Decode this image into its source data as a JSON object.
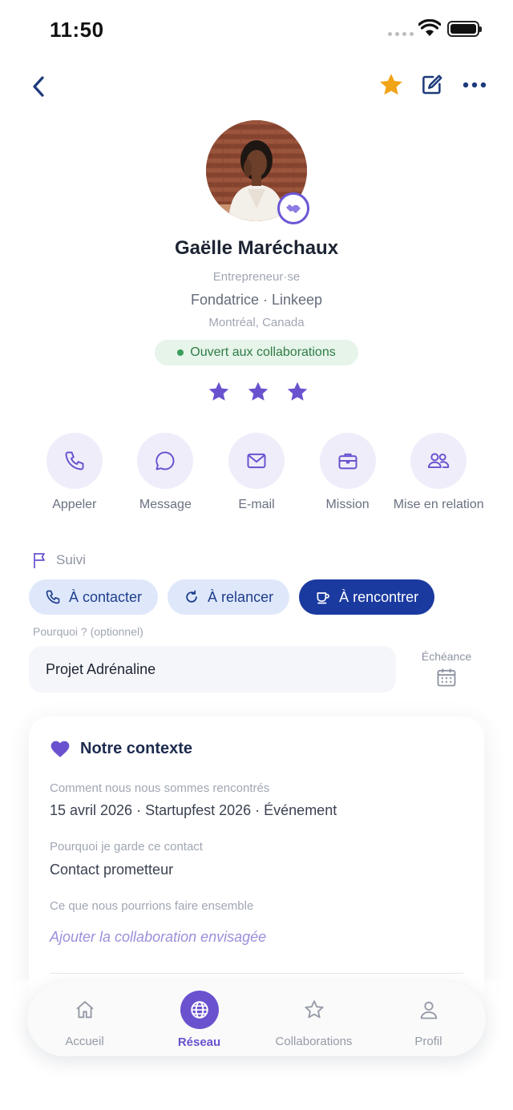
{
  "status_bar": {
    "time": "11:50"
  },
  "profile": {
    "name": "Gaëlle Maréchaux",
    "role": "Entrepreneur·se",
    "company": "Fondatrice · Linkeep",
    "location": "Montréal, Canada",
    "availability": "Ouvert aux collaborations",
    "rating": 3,
    "rating_max": 3
  },
  "actions": [
    {
      "label": "Appeler",
      "icon": "phone-icon"
    },
    {
      "label": "Message",
      "icon": "message-icon"
    },
    {
      "label": "E-mail",
      "icon": "mail-icon"
    },
    {
      "label": "Mission",
      "icon": "briefcase-icon"
    },
    {
      "label": "Mise en relation",
      "icon": "people-icon"
    }
  ],
  "followup": {
    "title": "Suivi",
    "chips": [
      {
        "label": "À contacter",
        "icon": "phone-icon",
        "selected": false
      },
      {
        "label": "À relancer",
        "icon": "refresh-icon",
        "selected": false
      },
      {
        "label": "À rencontrer",
        "icon": "coffee-icon",
        "selected": true
      }
    ],
    "reason_label": "Pourquoi ? (optionnel)",
    "reason_value": "Projet Adrénaline",
    "due_label": "Échéance"
  },
  "context": {
    "title": "Notre contexte",
    "fields": [
      {
        "label": "Comment nous nous sommes rencontrés",
        "value": "15 avril 2026 · Startupfest 2026 · Événement"
      },
      {
        "label": "Pourquoi je garde ce contact",
        "value": "Contact prometteur"
      },
      {
        "label": "Ce que nous pourrions faire ensemble",
        "placeholder": "Ajouter la collaboration envisagée"
      }
    ]
  },
  "bottom_nav": [
    {
      "label": "Accueil",
      "icon": "home-icon",
      "selected": false
    },
    {
      "label": "Réseau",
      "icon": "globe-icon",
      "selected": true
    },
    {
      "label": "Collaborations",
      "icon": "star-outline-icon",
      "selected": false
    },
    {
      "label": "Profil",
      "icon": "user-icon",
      "selected": false
    }
  ],
  "colors": {
    "accent": "#6a52cf",
    "primary": "#1a3aa0",
    "favorite": "#f2a417",
    "success": "#3a9d5a"
  }
}
